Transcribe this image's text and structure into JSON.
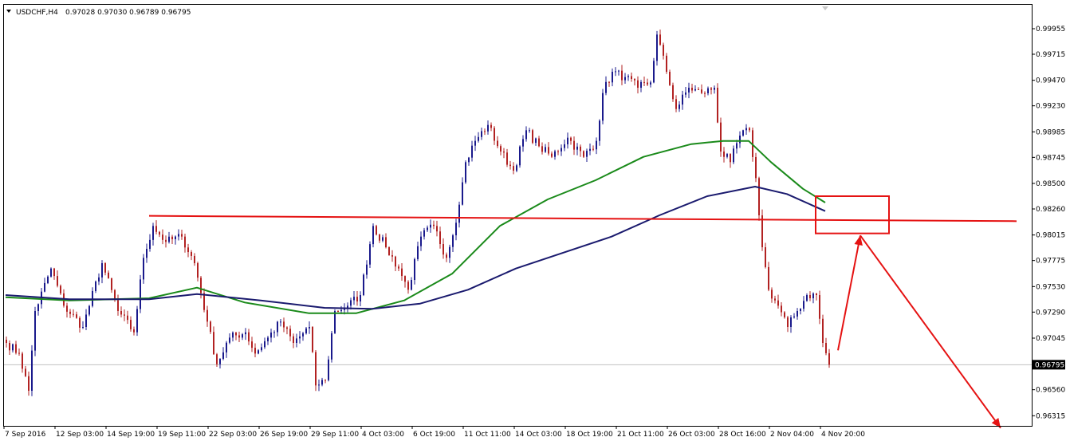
{
  "header": {
    "symbol_label": "USDCHF,H4",
    "ohlc_label": "0.97028 0.97030 0.96789 0.96795"
  },
  "colors": {
    "background": "#ffffff",
    "frame": "#000000",
    "bull_candle": "#1a1a8c",
    "bear_candle": "#b22222",
    "ma_green": "#1a8a1a",
    "ma_navy": "#1a1a6e",
    "annotation": "#e51212",
    "current_price_line": "#c0c0c0",
    "current_price_box": "#000000"
  },
  "chart_data": {
    "type": "candlestick",
    "y_ticks": [
      "0.99955",
      "0.99715",
      "0.99470",
      "0.99230",
      "0.98985",
      "0.98745",
      "0.98500",
      "0.98260",
      "0.98015",
      "0.97775",
      "0.97530",
      "0.97290",
      "0.97045",
      "0.96800",
      "0.96560",
      "0.96315"
    ],
    "ylim": [
      0.9622,
      1.0018
    ],
    "x_ticks": [
      "7 Sep 2016",
      "12 Sep 03:00",
      "14 Sep 19:00",
      "19 Sep 11:00",
      "22 Sep 03:00",
      "26 Sep 19:00",
      "29 Sep 11:00",
      "4 Oct 03:00",
      "6 Oct 19:00",
      "11 Oct 11:00",
      "14 Oct 03:00",
      "18 Oct 19:00",
      "21 Oct 11:00",
      "26 Oct 03:00",
      "28 Oct 16:00",
      "2 Nov 04:00",
      "4 Nov 20:00"
    ],
    "current_price": "0.96795",
    "price_series": [
      {
        "bar": 0,
        "price": 0.97
      },
      {
        "bar": 4,
        "price": 0.969
      },
      {
        "bar": 7,
        "price": 0.9655
      },
      {
        "bar": 9,
        "price": 0.973
      },
      {
        "bar": 14,
        "price": 0.977
      },
      {
        "bar": 18,
        "price": 0.9735
      },
      {
        "bar": 24,
        "price": 0.9715
      },
      {
        "bar": 30,
        "price": 0.9775
      },
      {
        "bar": 35,
        "price": 0.973
      },
      {
        "bar": 40,
        "price": 0.971
      },
      {
        "bar": 43,
        "price": 0.978
      },
      {
        "bar": 46,
        "price": 0.981
      },
      {
        "bar": 50,
        "price": 0.9795
      },
      {
        "bar": 55,
        "price": 0.98
      },
      {
        "bar": 59,
        "price": 0.9775
      },
      {
        "bar": 63,
        "price": 0.972
      },
      {
        "bar": 66,
        "price": 0.968
      },
      {
        "bar": 70,
        "price": 0.9705
      },
      {
        "bar": 75,
        "price": 0.971
      },
      {
        "bar": 78,
        "price": 0.969
      },
      {
        "bar": 82,
        "price": 0.9705
      },
      {
        "bar": 86,
        "price": 0.972
      },
      {
        "bar": 90,
        "price": 0.97
      },
      {
        "bar": 95,
        "price": 0.9715
      },
      {
        "bar": 97,
        "price": 0.966
      },
      {
        "bar": 100,
        "price": 0.9665
      },
      {
        "bar": 103,
        "price": 0.973
      },
      {
        "bar": 107,
        "price": 0.9735
      },
      {
        "bar": 111,
        "price": 0.9745
      },
      {
        "bar": 115,
        "price": 0.981
      },
      {
        "bar": 119,
        "price": 0.979
      },
      {
        "bar": 123,
        "price": 0.977
      },
      {
        "bar": 126,
        "price": 0.975
      },
      {
        "bar": 130,
        "price": 0.98
      },
      {
        "bar": 134,
        "price": 0.981
      },
      {
        "bar": 138,
        "price": 0.978
      },
      {
        "bar": 142,
        "price": 0.983
      },
      {
        "bar": 144,
        "price": 0.987
      },
      {
        "bar": 147,
        "price": 0.989
      },
      {
        "bar": 151,
        "price": 0.9905
      },
      {
        "bar": 155,
        "price": 0.988
      },
      {
        "bar": 159,
        "price": 0.9862
      },
      {
        "bar": 163,
        "price": 0.99
      },
      {
        "bar": 167,
        "price": 0.9885
      },
      {
        "bar": 171,
        "price": 0.9875
      },
      {
        "bar": 176,
        "price": 0.9893
      },
      {
        "bar": 181,
        "price": 0.9875
      },
      {
        "bar": 185,
        "price": 0.989
      },
      {
        "bar": 187,
        "price": 0.9935
      },
      {
        "bar": 190,
        "price": 0.9955
      },
      {
        "bar": 194,
        "price": 0.995
      },
      {
        "bar": 198,
        "price": 0.994
      },
      {
        "bar": 202,
        "price": 0.9945
      },
      {
        "bar": 204,
        "price": 0.999
      },
      {
        "bar": 207,
        "price": 0.9955
      },
      {
        "bar": 210,
        "price": 0.992
      },
      {
        "bar": 214,
        "price": 0.994
      },
      {
        "bar": 218,
        "price": 0.9935
      },
      {
        "bar": 222,
        "price": 0.994
      },
      {
        "bar": 224,
        "price": 0.988
      },
      {
        "bar": 227,
        "price": 0.987
      },
      {
        "bar": 230,
        "price": 0.9895
      },
      {
        "bar": 233,
        "price": 0.99
      },
      {
        "bar": 235,
        "price": 0.9855
      },
      {
        "bar": 236,
        "price": 0.982
      },
      {
        "bar": 237,
        "price": 0.979
      },
      {
        "bar": 239,
        "price": 0.975
      },
      {
        "bar": 242,
        "price": 0.9735
      },
      {
        "bar": 245,
        "price": 0.9715
      },
      {
        "bar": 248,
        "price": 0.973
      },
      {
        "bar": 251,
        "price": 0.9745
      },
      {
        "bar": 254,
        "price": 0.9745
      },
      {
        "bar": 256,
        "price": 0.97
      },
      {
        "bar": 258,
        "price": 0.96795
      }
    ],
    "moving_averages": [
      {
        "name": "",
        "color": "#1a8a1a",
        "points": [
          {
            "bar": 0,
            "price": 0.9743
          },
          {
            "bar": 20,
            "price": 0.974
          },
          {
            "bar": 45,
            "price": 0.9742
          },
          {
            "bar": 60,
            "price": 0.9752
          },
          {
            "bar": 75,
            "price": 0.9738
          },
          {
            "bar": 95,
            "price": 0.9728
          },
          {
            "bar": 110,
            "price": 0.9728
          },
          {
            "bar": 125,
            "price": 0.974
          },
          {
            "bar": 140,
            "price": 0.9765
          },
          {
            "bar": 155,
            "price": 0.981
          },
          {
            "bar": 170,
            "price": 0.9835
          },
          {
            "bar": 185,
            "price": 0.9853
          },
          {
            "bar": 200,
            "price": 0.9875
          },
          {
            "bar": 215,
            "price": 0.9887
          },
          {
            "bar": 225,
            "price": 0.989
          },
          {
            "bar": 233,
            "price": 0.989
          },
          {
            "bar": 240,
            "price": 0.987
          },
          {
            "bar": 250,
            "price": 0.9845
          },
          {
            "bar": 257,
            "price": 0.9832
          }
        ]
      },
      {
        "name": "",
        "color": "#1a1a6e",
        "points": [
          {
            "bar": 0,
            "price": 0.9745
          },
          {
            "bar": 20,
            "price": 0.9741
          },
          {
            "bar": 45,
            "price": 0.9741
          },
          {
            "bar": 60,
            "price": 0.9746
          },
          {
            "bar": 80,
            "price": 0.974
          },
          {
            "bar": 100,
            "price": 0.9733
          },
          {
            "bar": 115,
            "price": 0.9732
          },
          {
            "bar": 130,
            "price": 0.9737
          },
          {
            "bar": 145,
            "price": 0.975
          },
          {
            "bar": 160,
            "price": 0.977
          },
          {
            "bar": 175,
            "price": 0.9785
          },
          {
            "bar": 190,
            "price": 0.98
          },
          {
            "bar": 205,
            "price": 0.982
          },
          {
            "bar": 220,
            "price": 0.9838
          },
          {
            "bar": 235,
            "price": 0.9847
          },
          {
            "bar": 245,
            "price": 0.984
          },
          {
            "bar": 257,
            "price": 0.9824
          }
        ]
      }
    ],
    "annotations": {
      "horizontal_line": {
        "start_bar": 45,
        "end_bar": 317,
        "start_price": 0.98195,
        "end_price": 0.98145
      },
      "box": {
        "start_bar": 254,
        "end_bar": 277,
        "top_price": 0.9838,
        "bottom_price": 0.9803
      },
      "arrow_up": {
        "from_bar": 261,
        "from_price": 0.9693,
        "to_bar": 268,
        "to_price": 0.9801
      },
      "arrow_down": {
        "from_bar": 268,
        "from_price": 0.9801,
        "to_bar": 312,
        "to_price": 0.962
      }
    }
  }
}
